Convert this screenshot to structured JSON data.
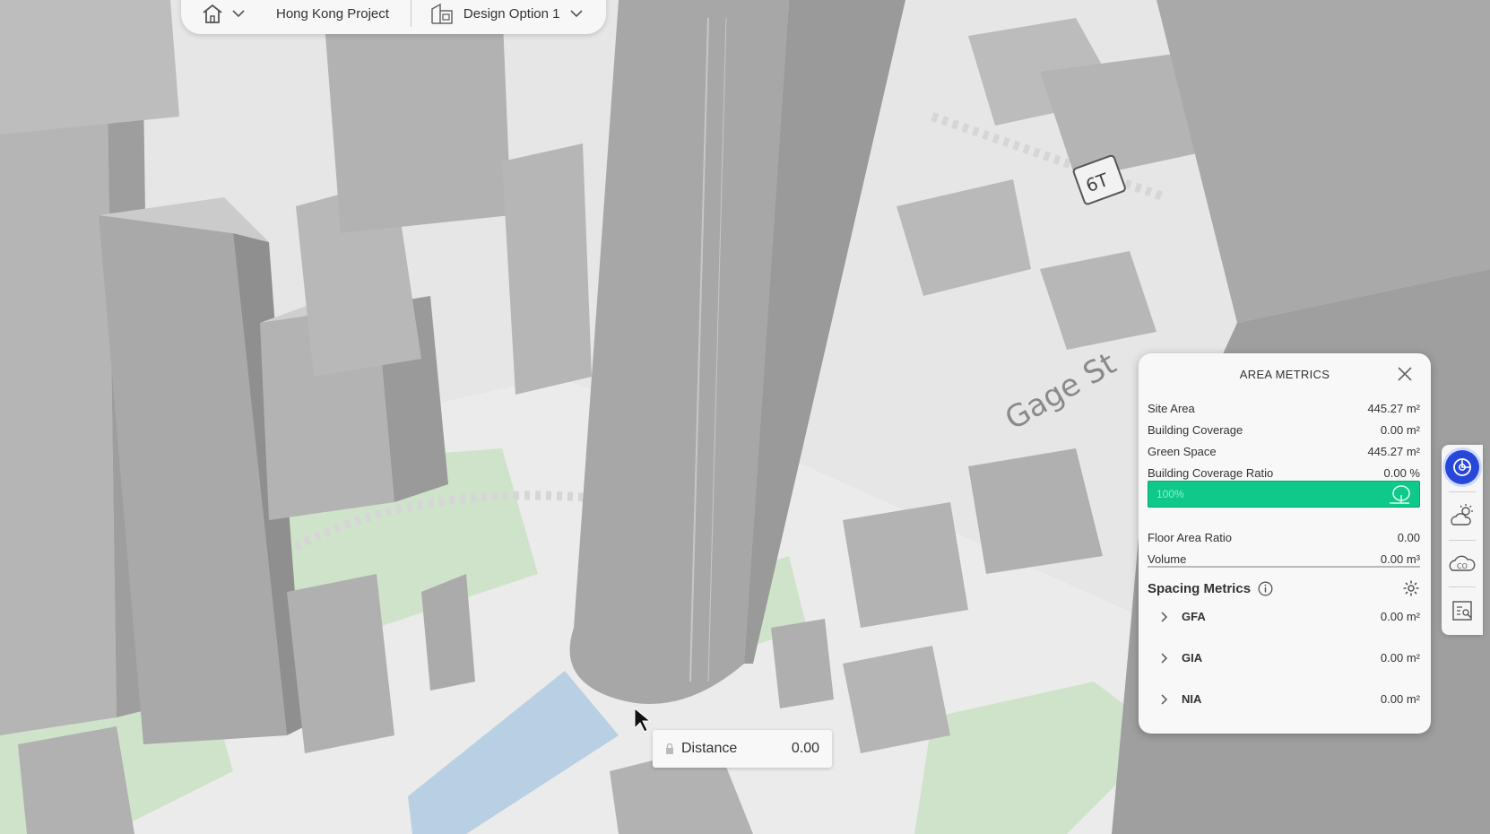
{
  "topbar": {
    "home_icon": "home-icon",
    "project_name": "Hong Kong Project",
    "design_option": "Design Option 1"
  },
  "map": {
    "street_label": "Gage St",
    "road_marking": "6T"
  },
  "distance": {
    "label": "Distance",
    "value": "0.00"
  },
  "area_metrics": {
    "title": "AREA METRICS",
    "rows": [
      {
        "label": "Site Area",
        "value": "445.27 m²"
      },
      {
        "label": "Building Coverage",
        "value": "0.00 m²"
      },
      {
        "label": "Green Space",
        "value": "445.27 m²"
      },
      {
        "label": "Building Coverage Ratio",
        "value": "0.00 %"
      }
    ],
    "coverage_bar": {
      "label": "100%",
      "fill": 1.0,
      "color": "#0fc98a"
    },
    "rows2": [
      {
        "label": "Floor Area Ratio",
        "value": "0.00"
      },
      {
        "label": "Volume",
        "value": "0.00 m³"
      }
    ],
    "spacing_title": "Spacing Metrics",
    "expandables": [
      {
        "label": "GFA",
        "value": "0.00 m²"
      },
      {
        "label": "GIA",
        "value": "0.00 m²"
      },
      {
        "label": "NIA",
        "value": "0.00 m²"
      }
    ]
  },
  "side_toolbar": {
    "icons": [
      "metrics-icon",
      "sun-cloud-icon",
      "co2-cloud-icon",
      "report-icon"
    ],
    "active_color": "#2747d8",
    "co2_label": "CO"
  }
}
